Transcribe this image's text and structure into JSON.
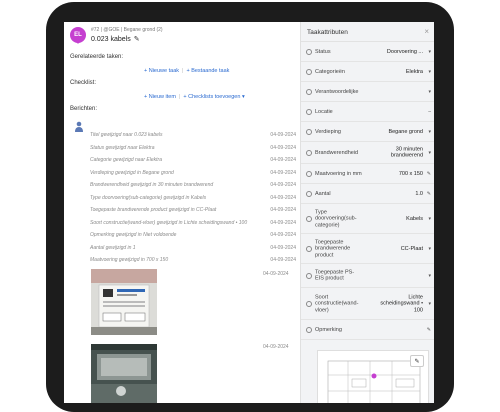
{
  "header": {
    "avatar": "EL",
    "subtitle": "#72 | @GOE | Begane grond (2)",
    "title": "0.023 kabels"
  },
  "sections": {
    "related_tasks": "Gerelateerde taken:",
    "checklist": "Checklist:",
    "messages": "Berichten:"
  },
  "actions": {
    "new_task": "+ Nieuwe taak",
    "existing_task": "+ Bestaande taak",
    "new_item": "+ Nieuw item",
    "add_checklists": "+ Checklists toevoegen ▾"
  },
  "messages": [
    {
      "text": "Titel gewijzigd naar 0.023 kabels",
      "date": "04-09-2024"
    },
    {
      "text": "Status gewijzigd naar Elektra",
      "date": "04-09-2024"
    },
    {
      "text": "Categorie gewijzigd naar Elektra",
      "date": "04-09-2024"
    },
    {
      "text": "Verdieping gewijzigd in Begane grond",
      "date": "04-09-2024"
    },
    {
      "text": "Brandwerendheid gewijzigd in 30 minuten brandwerend",
      "date": "04-09-2024"
    },
    {
      "text": "Type doorvoering(sub-categorie) gewijzigd in Kabels",
      "date": "04-09-2024"
    },
    {
      "text": "Toegepaste brandwerende product gewijzigd in CC-Plaat",
      "date": "04-09-2024"
    },
    {
      "text": "Soort constructie(wand-vloer) gewijzigd in Lichte scheidingswand • 100",
      "date": "04-09-2024"
    },
    {
      "text": "Opmerking gewijzigd in Niet voldoende",
      "date": "04-09-2024"
    },
    {
      "text": "Aantal gewijzigd in 1",
      "date": "04-09-2024"
    },
    {
      "text": "Maatvoering gewijzigd in 700 x 150",
      "date": "04-09-2024"
    }
  ],
  "photos": [
    {
      "date": "04-09-2024"
    },
    {
      "date": "04-09-2024"
    }
  ],
  "panel": {
    "title": "Taakattributen",
    "close": "×",
    "rows": [
      {
        "label": "Status",
        "value": "Doorvoering ...",
        "control": "▾"
      },
      {
        "label": "Categorieën",
        "value": "Elektra",
        "control": "▾"
      },
      {
        "label": "Verantwoordelijke",
        "value": "",
        "control": "▾"
      },
      {
        "label": "Locatie",
        "value": "",
        "control": "–"
      },
      {
        "label": "Verdieping",
        "value": "Begane grond",
        "control": "▾"
      },
      {
        "label": "Brandwerendheid",
        "value": "30 minuten brandwerend",
        "control": "▾"
      },
      {
        "label": "Maatvoering in mm",
        "value": "700 x 150",
        "control": "✎"
      },
      {
        "label": "Aantal",
        "value": "1.0",
        "control": "✎"
      },
      {
        "label": "Type doorvoering(sub-categorie)",
        "value": "Kabels",
        "control": "▾"
      },
      {
        "label": "Toegepaste brandwerende product",
        "value": "CC-Plaat",
        "control": "▾"
      },
      {
        "label": "Toegepaste PS-EIS product",
        "value": "",
        "control": "▾"
      },
      {
        "label": "Soort constructie(wand-vloer)",
        "value": "Lichte scheidingswand • 100",
        "control": "▾"
      },
      {
        "label": "Opmerking",
        "value": "",
        "control": "✎"
      }
    ]
  },
  "colors": {
    "accent": "#c53fd0",
    "link": "#2a6ad0",
    "panel_bg": "#f2f3f5"
  }
}
